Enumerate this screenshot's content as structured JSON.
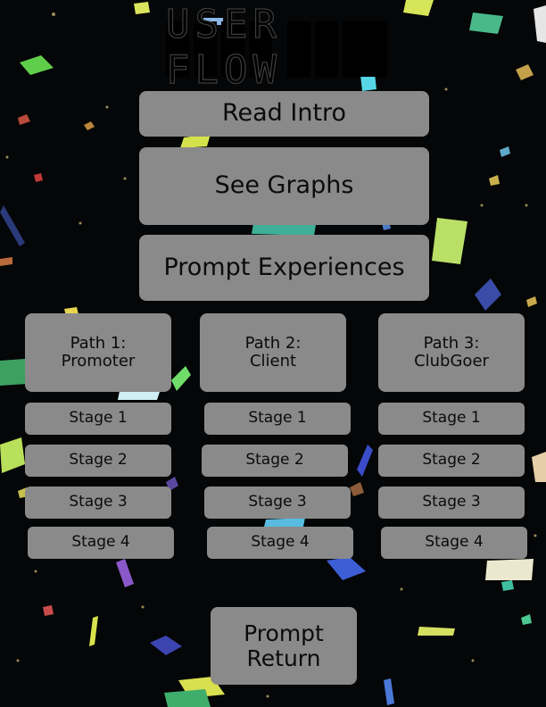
{
  "title": "USER FLOW",
  "buttons": {
    "read_intro": "Read Intro",
    "see_graphs": "See Graphs",
    "prompt_experiences": "Prompt Experiences",
    "prompt_return": "Prompt\nReturn"
  },
  "paths": [
    {
      "label": "Path 1:\nPromoter",
      "stages": [
        "Stage 1",
        "Stage 2",
        "Stage 3",
        "Stage 4"
      ]
    },
    {
      "label": "Path 2:\nClient",
      "stages": [
        "Stage 1",
        "Stage 2",
        "Stage 3",
        "Stage 4"
      ]
    },
    {
      "label": "Path 3:\nClubGoer",
      "stages": [
        "Stage 1",
        "Stage 2",
        "Stage 3",
        "Stage 4"
      ]
    }
  ],
  "colors": {
    "background": "#050607",
    "button": "#8a8a8a",
    "text": "#0b0b0b"
  }
}
